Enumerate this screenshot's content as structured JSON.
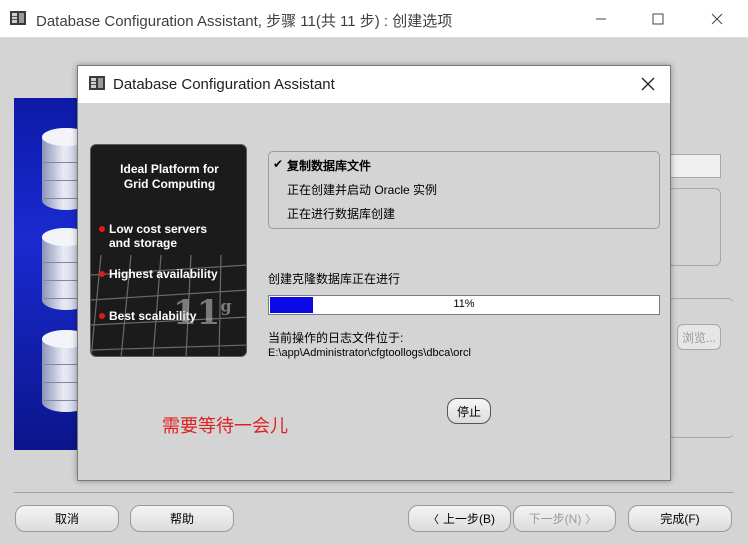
{
  "outer_window": {
    "title": "Database Configuration Assistant, 步骤 11(共 11 步) : 创建选项",
    "app_icon": "dbca-app-icon",
    "minimize_icon": "minimize-icon",
    "maximize_icon": "maximize-icon",
    "close_icon": "close-icon"
  },
  "background": {
    "browse_label": "浏览..."
  },
  "buttons": {
    "cancel": "取消",
    "help": "帮助",
    "back": "上一步(B)",
    "next": "下一步(N)",
    "finish": "完成(F)"
  },
  "dialog": {
    "title": "Database Configuration Assistant",
    "promo": {
      "title_line1": "Ideal Platform for",
      "title_line2": "Grid Computing",
      "item1_line1": "Low cost servers",
      "item1_line2": "and storage",
      "item2": "Highest availability",
      "item3": "Best scalability",
      "logo_main": "11",
      "logo_sup": "g"
    },
    "steps": [
      {
        "label": "复制数据库文件",
        "done": true
      },
      {
        "label": "正在创建并启动 Oracle 实例",
        "done": false
      },
      {
        "label": "正在进行数据库创建",
        "done": false
      }
    ],
    "check_mark": "✔",
    "progress_label": "创建克隆数据库正在进行",
    "progress_percent": 11,
    "progress_text": "11%",
    "log_label": "当前操作的日志文件位于:",
    "log_path": "E:\\app\\Administrator\\cfgtoollogs\\dbca\\orcl",
    "stop_button": "停止"
  },
  "annotation": "需要等待一会儿",
  "colors": {
    "progress_fill": "#0a0ae6",
    "annotation": "#e02020",
    "promo_bullet": "#e01c1c"
  }
}
